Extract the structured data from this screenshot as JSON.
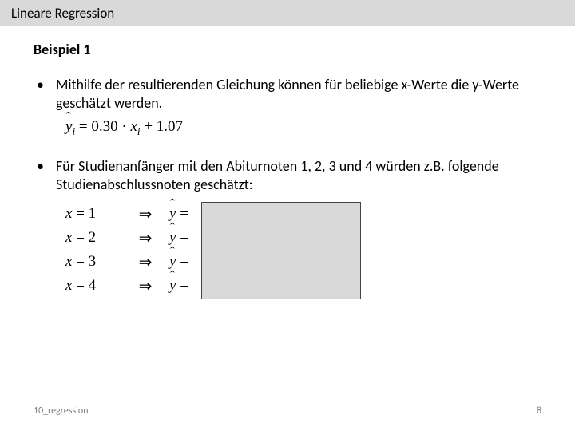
{
  "header": {
    "title": "Lineare Regression"
  },
  "subtitle": "Beispiel 1",
  "bullets": [
    "Mithilfe der resultierenden Gleichung können für beliebige x-Werte die y-Werte geschätzt werden.",
    "Für Studienanfänger mit den Abiturnoten 1, 2, 3 und 4 würden z.B. folgende Studienabschlussnoten geschätzt:"
  ],
  "equation": {
    "slope": "0.30",
    "intercept": "1.07"
  },
  "examples": [
    {
      "x": "1"
    },
    {
      "x": "2"
    },
    {
      "x": "3"
    },
    {
      "x": "4"
    }
  ],
  "footer": {
    "left": "10_regression",
    "page": "8"
  }
}
